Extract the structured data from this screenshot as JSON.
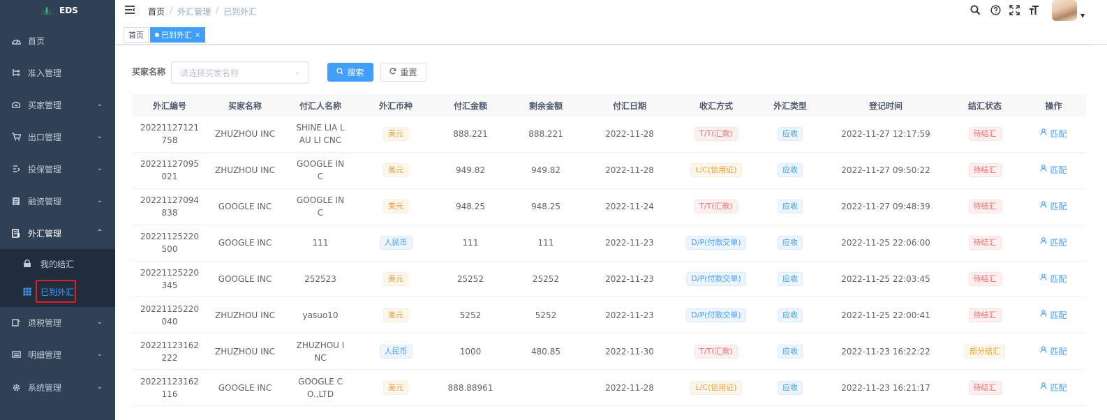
{
  "app": {
    "brand": "EDS"
  },
  "colors": {
    "sidebar_bg": "#304156",
    "primary": "#409eff",
    "active_outline": "#e02020"
  },
  "sidebar": {
    "items": [
      {
        "label": "首页",
        "icon": "dashboard-icon",
        "arrow": ""
      },
      {
        "label": "准入管理",
        "icon": "tree-icon",
        "arrow": ""
      },
      {
        "label": "买家管理",
        "icon": "buyer-icon",
        "arrow": "⌄"
      },
      {
        "label": "出口管理",
        "icon": "cart-icon",
        "arrow": "⌄"
      },
      {
        "label": "投保管理",
        "icon": "insurance-icon",
        "arrow": "⌄"
      },
      {
        "label": "融资管理",
        "icon": "finance-icon",
        "arrow": "⌄"
      },
      {
        "label": "外汇管理",
        "icon": "exchange-icon",
        "arrow": "⌃"
      },
      {
        "label": "退税管理",
        "icon": "tax-icon",
        "arrow": "⌄"
      },
      {
        "label": "明细管理",
        "icon": "detail-icon",
        "arrow": "⌄"
      },
      {
        "label": "系统管理",
        "icon": "gear-icon",
        "arrow": "⌄"
      }
    ],
    "sub_items": [
      {
        "label": "我的结汇",
        "icon": "lock-icon"
      },
      {
        "label": "已到外汇",
        "icon": "table-icon"
      }
    ]
  },
  "header": {
    "breadcrumb": [
      "首页",
      "外汇管理",
      "已到外汇"
    ],
    "breadcrumb_sep": "/"
  },
  "tags": [
    {
      "label": "首页"
    },
    {
      "label": "已到外汇",
      "close": "×"
    }
  ],
  "search": {
    "label": "买家名称",
    "placeholder": "请选择买家名称",
    "search_button": "搜索",
    "reset_button": "重置"
  },
  "table": {
    "columns": [
      "外汇编号",
      "买家名称",
      "付汇人名称",
      "外汇币种",
      "付汇金额",
      "剩余金额",
      "付汇日期",
      "收汇方式",
      "外汇类型",
      "登记时间",
      "结汇状态",
      "操作"
    ],
    "rows": [
      {
        "id": "20221127121758",
        "buyer": "ZHUZHOU INC",
        "payer": "SHINE LIA LAU LI CNC",
        "currency": "美元",
        "currency_type": "warning",
        "amount": "888.221",
        "remain": "888.221",
        "date": "2022-11-28",
        "method": "T/T(汇款)",
        "type": "应收",
        "time": "2022-11-27 12:17:59",
        "status": "待结汇",
        "action": "匹配"
      },
      {
        "id": "20221127095021",
        "buyer": "ZHUZHOU INC",
        "payer": "GOOGLE INC",
        "currency": "美元",
        "currency_type": "warning",
        "amount": "949.82",
        "remain": "949.82",
        "date": "2022-11-28",
        "method": "L/C(信用证)",
        "type": "应收",
        "time": "2022-11-27 09:50:22",
        "status": "待结汇",
        "action": "匹配"
      },
      {
        "id": "20221127094838",
        "buyer": "GOOGLE INC",
        "payer": "GOOGLE INC",
        "currency": "美元",
        "currency_type": "warning",
        "amount": "948.25",
        "remain": "948.25",
        "date": "2022-11-24",
        "method": "T/T(汇款)",
        "type": "应收",
        "time": "2022-11-27 09:48:39",
        "status": "待结汇",
        "action": "匹配"
      },
      {
        "id": "20221125220500",
        "buyer": "GOOGLE INC",
        "payer": "111",
        "currency": "人民币",
        "currency_type": "info",
        "amount": "111",
        "remain": "111",
        "date": "2022-11-23",
        "method": "D/P(付款交单)",
        "type": "应收",
        "time": "2022-11-25 22:06:00",
        "status": "待结汇",
        "action": "匹配"
      },
      {
        "id": "20221125220345",
        "buyer": "GOOGLE INC",
        "payer": "252523",
        "currency": "美元",
        "currency_type": "warning",
        "amount": "25252",
        "remain": "25252",
        "date": "2022-11-23",
        "method": "D/P(付款交单)",
        "type": "应收",
        "time": "2022-11-25 22:03:45",
        "status": "待结汇",
        "action": "匹配"
      },
      {
        "id": "20221125220040",
        "buyer": "ZHUZHOU INC",
        "payer": "yasuo10",
        "currency": "美元",
        "currency_type": "warning",
        "amount": "5252",
        "remain": "5252",
        "date": "2022-11-23",
        "method": "D/P(付款交单)",
        "type": "应收",
        "time": "2022-11-25 22:00:41",
        "status": "待结汇",
        "action": "匹配"
      },
      {
        "id": "20221123162222",
        "buyer": "ZHUZHOU INC",
        "payer": "ZHUZHOU INC",
        "currency": "人民币",
        "currency_type": "info",
        "amount": "1000",
        "remain": "480.85",
        "date": "2022-11-30",
        "method": "T/T(汇款)",
        "type": "应收",
        "time": "2022-11-23 16:22:22",
        "status": "部分结汇",
        "action": "匹配"
      },
      {
        "id": "20221123162116",
        "buyer": "GOOGLE INC",
        "payer": "GOOGLE CO.,LTD",
        "currency": "美元",
        "currency_type": "warning",
        "amount": "888.88961",
        "remain": "",
        "date": "2022-11-28",
        "method": "L/C(信用证)",
        "type": "应收",
        "time": "2022-11-23 16:21:17",
        "status": "待结汇",
        "action": "匹配"
      }
    ]
  }
}
